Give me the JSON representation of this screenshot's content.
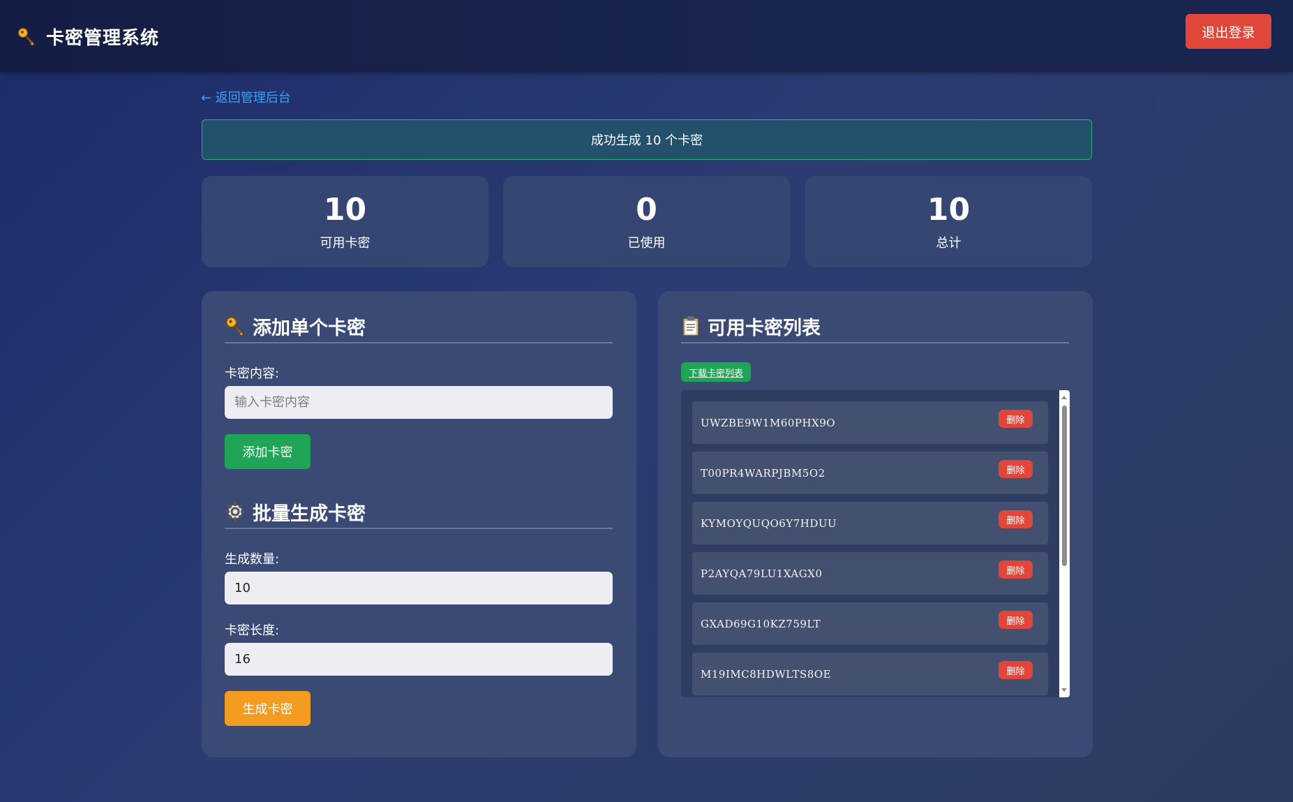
{
  "header": {
    "title": "卡密管理系统",
    "logout_label": "退出登录"
  },
  "nav": {
    "back_label": "← 返回管理后台"
  },
  "alert": {
    "message": "成功生成 10 个卡密"
  },
  "stats": [
    {
      "value": "10",
      "label": "可用卡密"
    },
    {
      "value": "0",
      "label": "已使用"
    },
    {
      "value": "10",
      "label": "总计"
    }
  ],
  "add_single": {
    "heading": "添加单个卡密",
    "field_label": "卡密内容:",
    "placeholder": "输入卡密内容",
    "button_label": "添加卡密"
  },
  "batch": {
    "heading": "批量生成卡密",
    "count_label": "生成数量:",
    "count_value": "10",
    "length_label": "卡密长度:",
    "length_value": "16",
    "button_label": "生成卡密"
  },
  "card_list": {
    "heading": "可用卡密列表",
    "download_label": "下载卡密列表",
    "delete_label": "删除",
    "items": [
      "UWZBE9W1M60PHX9O",
      "T00PR4WARPJBM5O2",
      "KYMOYQUQO6Y7HDUU",
      "P2AYQA79LU1XAGX0",
      "GXAD69G10KZ759LT",
      "M19IMC8HDWLTS8OE"
    ]
  },
  "icons": {
    "brand": "key-icon",
    "add_heading": "key-icon",
    "batch_heading": "gear-icon",
    "list_heading": "clipboard-icon"
  },
  "colors": {
    "danger": "#e0463a",
    "success": "#1fa555",
    "warning": "#f39c1f",
    "link": "#3ea1f0"
  }
}
